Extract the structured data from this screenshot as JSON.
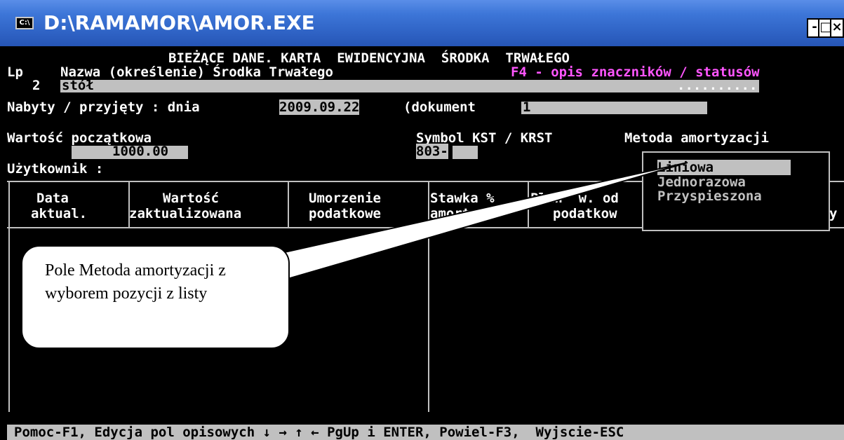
{
  "window": {
    "title": "D:\\RAMAMOR\\AMOR.EXE",
    "icon_text": "C:\\",
    "minimize_label": "-",
    "maximize_label": "□",
    "close_label": "×"
  },
  "header": {
    "title": "BIEŻĄCE DANE. KARTA  EWIDENCYJNA  ŚRODKA  TRWAŁEGO",
    "lp_label": "Lp",
    "name_label": "Nazwa (określenie) Środka Trwałego",
    "hint": "F4 - opis znaczników / statusów",
    "lp_value": "2",
    "name_value": "stół",
    "dots": "..........",
    "acquired_label": "Nabyty / przyjęty : dnia",
    "acquired_date": "2009.09.22",
    "document_label": "(dokument",
    "document_value": "1"
  },
  "fields": {
    "initial_value_label": "Wartość początkowa",
    "initial_value": "1000.00",
    "symbol_label": "Symbol KST / KRST",
    "symbol_value": "803-",
    "method_label": "Metoda amortyzacji",
    "user_label": "Użytkownik :"
  },
  "table": {
    "columns": [
      {
        "line1": "Data",
        "line2": "aktual."
      },
      {
        "line1": "Wartość",
        "line2": "zaktualizowana"
      },
      {
        "line1": "Umorzenie",
        "line2": "podatkowe"
      },
      {
        "line1": "Stawka %",
        "line2": "amorty"
      },
      {
        "line1": "Plan  w. od",
        "line2": "podatkow"
      },
      {
        "line1": "",
        "line2": "y"
      }
    ]
  },
  "method_dropdown": {
    "options": [
      "Liniowa",
      "Jednorazowa",
      "Przyspieszona"
    ],
    "selected": "Liniowa"
  },
  "callout": {
    "text": "Pole Metoda amortyzacji z wyborem pozycji z listy"
  },
  "status": {
    "text": "Pomoc-F1, Edycja pol opisowych ↓ → ↑ ← PgUp i ENTER, Powiel-F3,  Wyjscie-ESC"
  }
}
